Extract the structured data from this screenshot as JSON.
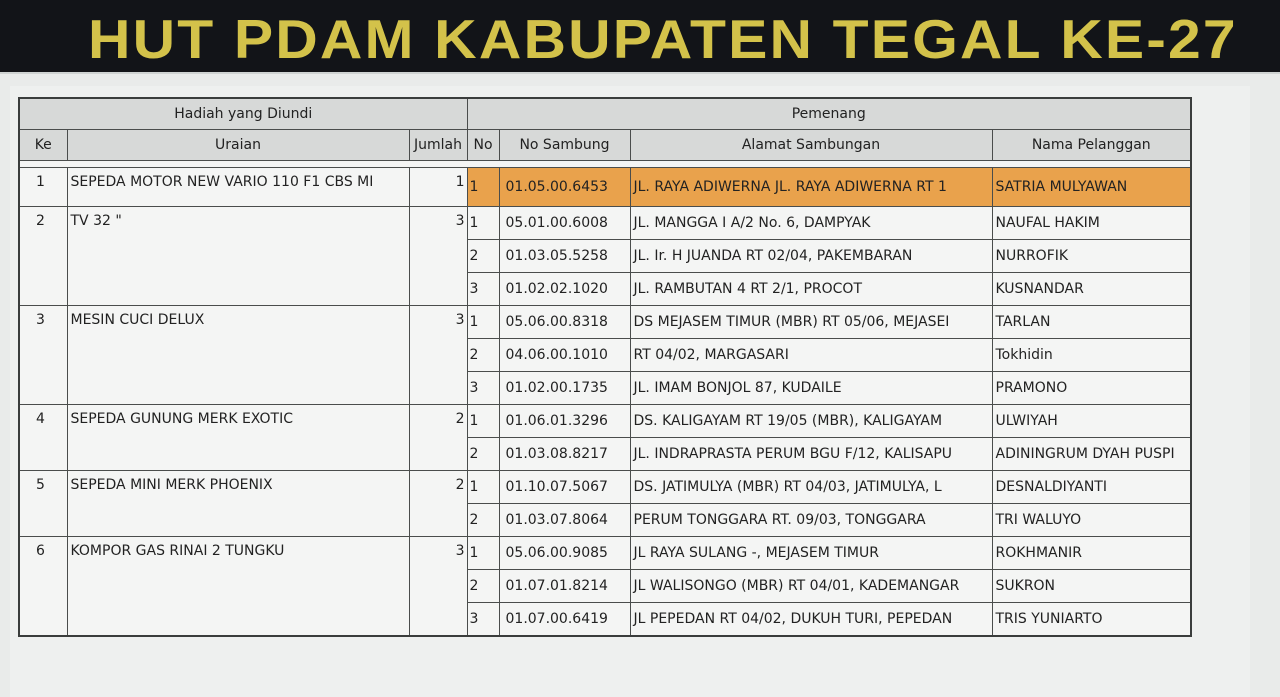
{
  "banner": {
    "title": "HUT PDAM KABUPATEN TEGAL KE-27"
  },
  "table": {
    "group_headers": {
      "prize": "Hadiah yang Diundi",
      "winner": "Pemenang"
    },
    "columns": {
      "ke": "Ke",
      "uraian": "Uraian",
      "jumlah": "Jumlah",
      "no": "No",
      "no_sambung": "No Sambung",
      "alamat": "Alamat Sambungan",
      "nama": "Nama Pelanggan"
    },
    "highlight_color": "#e9a24c",
    "prizes": [
      {
        "ke": "1",
        "uraian": "SEPEDA MOTOR NEW VARIO 110 F1 CBS MI",
        "jumlah": "1",
        "winners": [
          {
            "no": "1",
            "no_sambung": "01.05.00.6453",
            "alamat": "JL. RAYA ADIWERNA JL. RAYA ADIWERNA RT 1",
            "nama": "SATRIA MULYAWAN",
            "highlighted": true
          }
        ]
      },
      {
        "ke": "2",
        "uraian": "TV 32 \"",
        "jumlah": "3",
        "winners": [
          {
            "no": "1",
            "no_sambung": "05.01.00.6008",
            "alamat": "JL. MANGGA I A/2 No. 6, DAMPYAK",
            "nama": "NAUFAL HAKIM"
          },
          {
            "no": "2",
            "no_sambung": "01.03.05.5258",
            "alamat": "JL. Ir. H JUANDA RT 02/04, PAKEMBARAN",
            "nama": "NURROFIK"
          },
          {
            "no": "3",
            "no_sambung": "01.02.02.1020",
            "alamat": "JL. RAMBUTAN 4 RT 2/1, PROCOT",
            "nama": "KUSNANDAR"
          }
        ]
      },
      {
        "ke": "3",
        "uraian": "MESIN CUCI DELUX",
        "jumlah": "3",
        "winners": [
          {
            "no": "1",
            "no_sambung": "05.06.00.8318",
            "alamat": "DS MEJASEM TIMUR (MBR) RT 05/06, MEJASEI",
            "nama": "TARLAN"
          },
          {
            "no": "2",
            "no_sambung": "04.06.00.1010",
            "alamat": "RT 04/02, MARGASARI",
            "nama": "Tokhidin"
          },
          {
            "no": "3",
            "no_sambung": "01.02.00.1735",
            "alamat": "JL. IMAM BONJOL 87, KUDAILE",
            "nama": "PRAMONO"
          }
        ]
      },
      {
        "ke": "4",
        "uraian": "SEPEDA GUNUNG MERK EXOTIC",
        "jumlah": "2",
        "winners": [
          {
            "no": "1",
            "no_sambung": "01.06.01.3296",
            "alamat": "DS. KALIGAYAM RT 19/05 (MBR), KALIGAYAM",
            "nama": "ULWIYAH"
          },
          {
            "no": "2",
            "no_sambung": "01.03.08.8217",
            "alamat": "JL. INDRAPRASTA PERUM BGU F/12, KALISAPU",
            "nama": "ADININGRUM DYAH PUSPI"
          }
        ]
      },
      {
        "ke": "5",
        "uraian": "SEPEDA MINI MERK PHOENIX",
        "jumlah": "2",
        "winners": [
          {
            "no": "1",
            "no_sambung": "01.10.07.5067",
            "alamat": "DS. JATIMULYA (MBR) RT 04/03, JATIMULYA, L",
            "nama": "DESNALDIYANTI"
          },
          {
            "no": "2",
            "no_sambung": "01.03.07.8064",
            "alamat": "PERUM TONGGARA RT. 09/03, TONGGARA",
            "nama": "TRI WALUYO"
          }
        ]
      },
      {
        "ke": "6",
        "uraian": "KOMPOR GAS RINAI 2 TUNGKU",
        "jumlah": "3",
        "winners": [
          {
            "no": "1",
            "no_sambung": "05.06.00.9085",
            "alamat": "JL RAYA SULANG -, MEJASEM TIMUR",
            "nama": "ROKHMANIR"
          },
          {
            "no": "2",
            "no_sambung": "01.07.01.8214",
            "alamat": "JL WALISONGO (MBR) RT 04/01, KADEMANGAR",
            "nama": "SUKRON"
          },
          {
            "no": "3",
            "no_sambung": "01.07.00.6419",
            "alamat": "JL PEPEDAN RT 04/02, DUKUH TURI, PEPEDAN",
            "nama": "TRIS YUNIARTO"
          }
        ]
      }
    ]
  }
}
